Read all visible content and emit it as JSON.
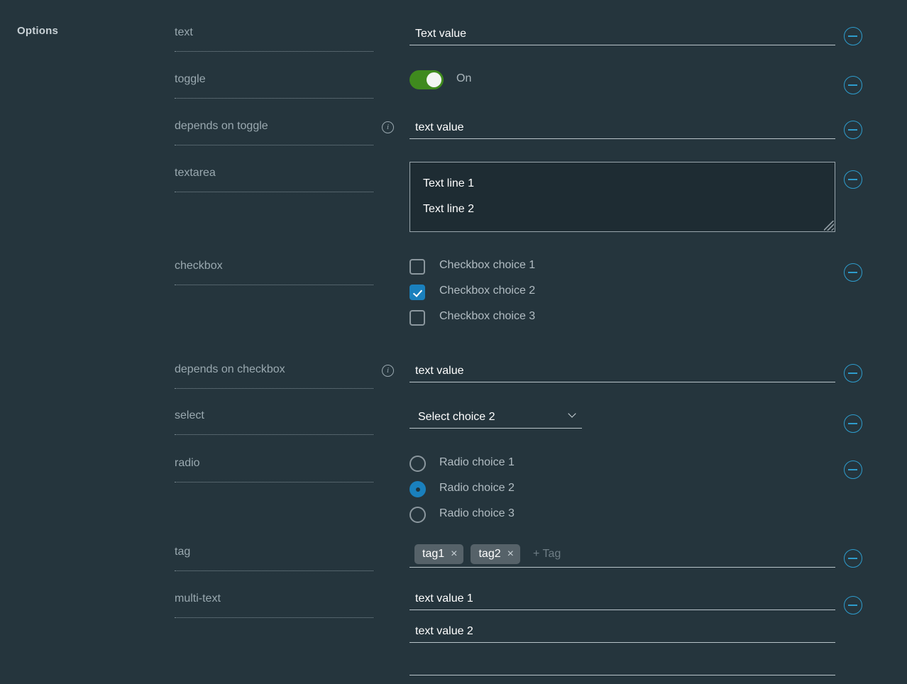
{
  "section": {
    "title": "Options"
  },
  "icons": {
    "info": "i",
    "tag_close": "×",
    "remove": "minus-circle-icon",
    "chevron": "chevron-down-icon"
  },
  "colors": {
    "background": "#25353d",
    "accent_blue": "#1a80bd",
    "remove_blue": "#2e9ccc",
    "toggle_on_green": "#3f8a1e",
    "label_text": "#9aa9b0",
    "value_text": "#ffffff",
    "tag_background": "#566269",
    "textarea_background": "#1e2c33"
  },
  "rows": [
    {
      "label": "text",
      "type": "text",
      "value": "Text value",
      "has_info": false
    },
    {
      "label": "toggle",
      "type": "toggle",
      "state": "on",
      "state_label": "On",
      "has_info": false
    },
    {
      "label": "depends on toggle",
      "type": "text",
      "value": "text value",
      "has_info": true
    },
    {
      "label": "textarea",
      "type": "textarea",
      "lines": [
        "Text line 1",
        "Text line 2"
      ],
      "has_info": false
    },
    {
      "label": "checkbox",
      "type": "checkbox",
      "has_info": false,
      "choices": [
        {
          "label": "Checkbox choice 1",
          "checked": false
        },
        {
          "label": "Checkbox choice 2",
          "checked": true
        },
        {
          "label": "Checkbox choice 3",
          "checked": false
        }
      ]
    },
    {
      "label": "depends on checkbox",
      "type": "text",
      "value": "text value",
      "has_info": true
    },
    {
      "label": "select",
      "type": "select",
      "value": "Select choice 2",
      "has_info": false
    },
    {
      "label": "radio",
      "type": "radio",
      "has_info": false,
      "choices": [
        {
          "label": "Radio choice 1",
          "selected": false
        },
        {
          "label": "Radio choice 2",
          "selected": true
        },
        {
          "label": "Radio choice 3",
          "selected": false
        }
      ]
    },
    {
      "label": "tag",
      "type": "tag",
      "has_info": false,
      "tags": [
        "tag1",
        "tag2"
      ],
      "placeholder": "+ Tag"
    },
    {
      "label": "multi-text",
      "type": "multi-text",
      "has_info": false,
      "values": [
        "text value 1",
        "text value 2",
        ""
      ]
    }
  ]
}
